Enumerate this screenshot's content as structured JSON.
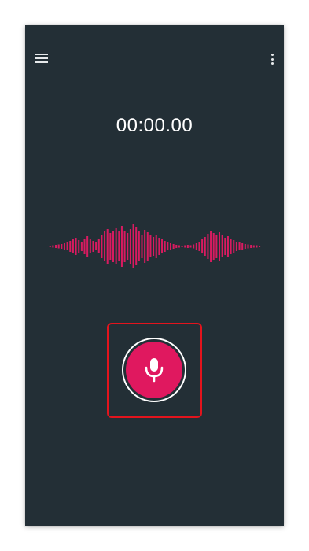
{
  "recorder": {
    "timer": "00:00.00"
  },
  "icons": {
    "menu": "hamburger-menu-icon",
    "more": "more-vert-icon",
    "record": "microphone-icon"
  },
  "colors": {
    "background": "#232f36",
    "waveform": "#d81b60",
    "record_button": "#e0185f",
    "highlight": "#e3141d"
  }
}
